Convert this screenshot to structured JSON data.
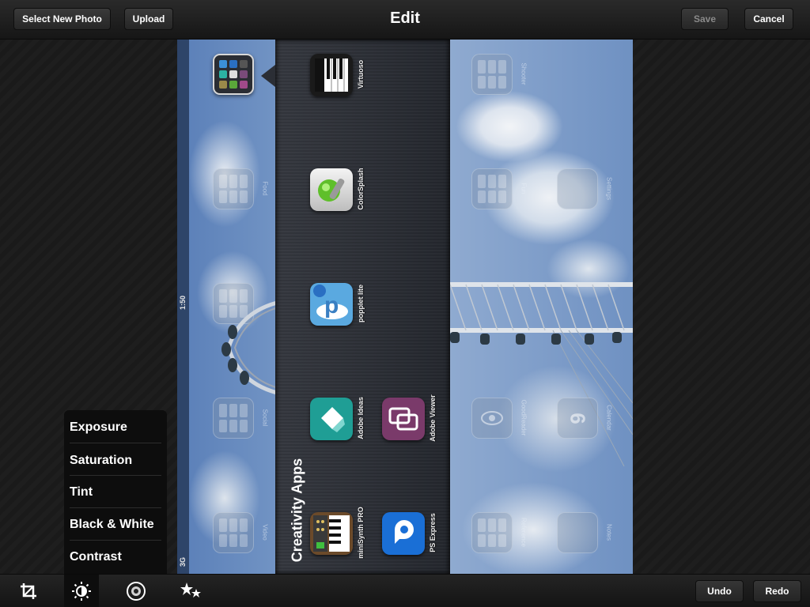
{
  "header": {
    "title": "Edit",
    "select_new_photo": "Select New Photo",
    "upload": "Upload",
    "save": "Save",
    "cancel": "Cancel"
  },
  "photo": {
    "status_time": "1:50",
    "status_network": "3G",
    "folder_name": "Creativity Apps",
    "apps": [
      {
        "label": "Virtuoso",
        "icon": "piano-icon"
      },
      {
        "label": "ColorSplash",
        "icon": "colorsplash-icon"
      },
      {
        "label": "popplet lite",
        "icon": "popplet-icon"
      },
      {
        "label": "Adobe Ideas",
        "icon": "adobe-ideas-icon"
      },
      {
        "label": "Adobe Viewer",
        "icon": "adobe-viewer-icon"
      },
      {
        "label": "miniSynth PRO",
        "icon": "synth-icon"
      },
      {
        "label": "PS Express",
        "icon": "ps-express-icon"
      }
    ],
    "background_labels": [
      "Food",
      "Social",
      "Video",
      "Shooter",
      "Fun",
      "Settings",
      "GoodReader",
      "Calendar",
      "Reference",
      "Notes"
    ],
    "calendar_day": "6",
    "calendar_weekday": "Wednesday"
  },
  "adjust_menu": {
    "items": [
      "Exposure",
      "Saturation",
      "Tint",
      "Black & White",
      "Contrast"
    ]
  },
  "toolbar": {
    "undo": "Undo",
    "redo": "Redo",
    "tools": [
      "crop-icon",
      "brightness-icon",
      "focus-icon",
      "effects-icon"
    ]
  },
  "colors": {
    "accent_dark": "#0d0d0d",
    "sky": "#7a9bc8",
    "panel": "#2b2e35"
  }
}
